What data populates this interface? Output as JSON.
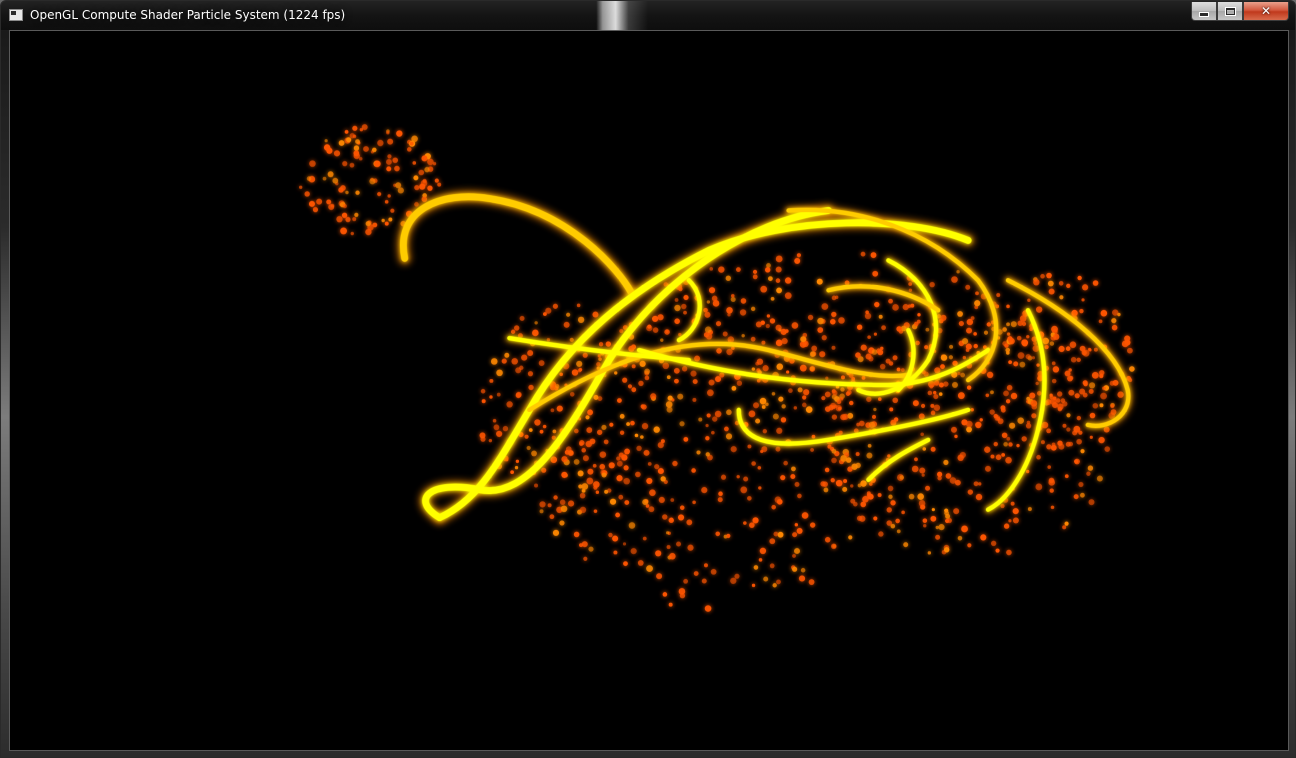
{
  "window": {
    "title": "OpenGL Compute Shader Particle System (1224 fps)",
    "icon": "app-window-icon",
    "buttons": {
      "minimize_icon": "minimize-icon",
      "maximize_icon": "maximize-icon",
      "close_icon": "close-icon",
      "close_glyph": "✕"
    }
  },
  "render": {
    "background": "#000000",
    "particle_colors": [
      "#ffff00",
      "#ffcc00",
      "#ff8800",
      "#ff5500"
    ]
  }
}
